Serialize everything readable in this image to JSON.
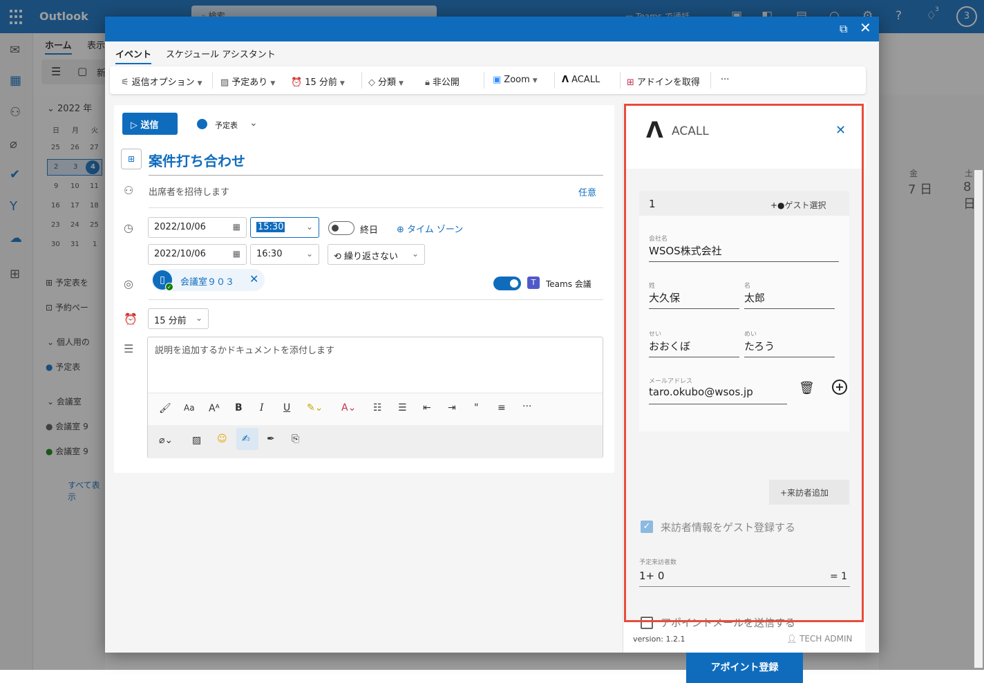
{
  "topbar": {
    "app_name": "Outlook",
    "search_placeholder": "検索",
    "teams_call": "Teams で通話",
    "bell_badge": "3",
    "avatar_initial": "3",
    "help": "?"
  },
  "ribbon": {
    "home_tab": "ホーム",
    "view_tab": "表示",
    "new_button_short": "新"
  },
  "calendar_panel": {
    "month": "2022 年",
    "weekdays": [
      "日",
      "月",
      "火"
    ],
    "weeks": [
      [
        "25",
        "26",
        "27"
      ],
      [
        "2",
        "3",
        "4"
      ],
      [
        "9",
        "10",
        "11"
      ],
      [
        "16",
        "17",
        "18"
      ],
      [
        "23",
        "24",
        "25"
      ],
      [
        "30",
        "31",
        "1"
      ]
    ],
    "add_calendar": "予定表を",
    "booking": "予約ペー",
    "personal_group": "個人用の",
    "personal_item": "予定表",
    "rooms_group": "会議室",
    "room1": "会議室 9",
    "room2": "会議室 9",
    "show_all": "すべて表示"
  },
  "right_calendar": {
    "fri_label": "金",
    "fri_date": "7 日",
    "sat_label": "土",
    "sat_date": "8 日"
  },
  "dialog": {
    "tabs": {
      "event": "イベント",
      "schedule": "スケジュール アシスタント"
    },
    "commands": {
      "reply_options": "返信オプション",
      "busy": "予定あり",
      "reminder": "15 分前",
      "category": "分類",
      "private": "非公開",
      "zoom": "Zoom",
      "acall": "ACALL",
      "get_addins": "アドインを取得",
      "more": "···"
    }
  },
  "form": {
    "send": "送信",
    "calendar": "予定表",
    "title": "案件打ち合わせ",
    "attendees_placeholder": "出席者を招待します",
    "optional": "任意",
    "start_date": "2022/10/06",
    "start_time": "15:30",
    "all_day": "終日",
    "time_zone": "タイム ゾーン",
    "end_date": "2022/10/06",
    "end_time": "16:30",
    "repeat": "繰り返さない",
    "room": "会議室９０３",
    "teams": "Teams 会議",
    "reminder": "15 分前",
    "body_placeholder": "説明を追加するかドキュメントを添付します"
  },
  "acall": {
    "name": "ACALL",
    "guest_number": "1",
    "guest_select": "ゲスト選択",
    "company_label": "会社名",
    "company": "WSOS株式会社",
    "last_name_label": "姓",
    "last_name": "大久保",
    "first_name_label": "名",
    "first_name": "太郎",
    "last_kana_label": "せい",
    "last_kana": "おおくぼ",
    "first_kana_label": "めい",
    "first_kana": "たろう",
    "email_label": "メールアドレス",
    "email": "taro.okubo@wsos.jp",
    "add_visitor": "+来訪者追加",
    "register_guest": "来訪者情報をゲスト登録する",
    "planned_label": "予定来訪者数",
    "planned_formula": "1+ 0",
    "planned_total": "= 1",
    "send_mail": "アポイントメールを送信する",
    "appointment_button": "アポイント登録",
    "version": "version: 1.2.1",
    "admin": "TECH ADMIN"
  },
  "colors": {
    "brand": "#0f6cbd",
    "highlight_border": "#e74c3c",
    "success": "#107c10"
  }
}
